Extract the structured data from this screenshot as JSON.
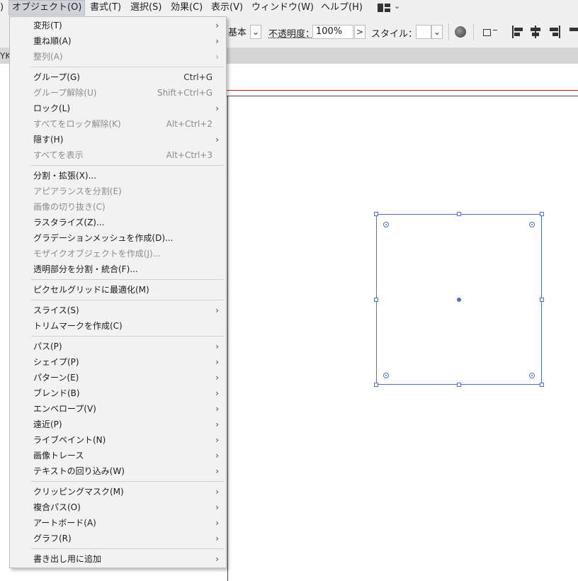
{
  "menubar": {
    "partial_left": ")",
    "items": [
      "オブジェクト(O)",
      "書式(T)",
      "選択(S)",
      "効果(C)",
      "表示(V)",
      "ウィンドウ(W)",
      "ヘルプ(H)"
    ],
    "active": "オブジェクト(O)",
    "workspace_icon": "workspace-switcher-icon"
  },
  "controlbar": {
    "brush_value": "基本",
    "opacity_label": "不透明度：",
    "opacity_value": "100%",
    "style_label": "スタイル：",
    "chevron_down": "⌄",
    "chevron_right": ">",
    "icons": [
      "recolor-globe-icon",
      "transform-shape-icon",
      "align-left-icon",
      "align-hcenter-icon",
      "align-right-icon"
    ]
  },
  "tabstrip": {
    "fragment": "YK"
  },
  "object_menu": {
    "items": [
      {
        "label": "変形(T)",
        "submenu": true
      },
      {
        "label": "重ね順(A)",
        "submenu": true
      },
      {
        "label": "整列(A)",
        "submenu": true,
        "disabled": true
      },
      {
        "label": "グループ(G)",
        "shortcut": "Ctrl+G"
      },
      {
        "label": "グループ解除(U)",
        "shortcut": "Shift+Ctrl+G",
        "disabled": true
      },
      {
        "label": "ロック(L)",
        "submenu": true
      },
      {
        "label": "すべてをロック解除(K)",
        "shortcut": "Alt+Ctrl+2",
        "disabled": true
      },
      {
        "label": "隠す(H)",
        "submenu": true
      },
      {
        "label": "すべてを表示",
        "shortcut": "Alt+Ctrl+3",
        "disabled": true
      },
      {
        "label": "分割・拡張(X)..."
      },
      {
        "label": "アピアランスを分割(E)",
        "disabled": true
      },
      {
        "label": "画像の切り抜き(C)",
        "disabled": true
      },
      {
        "label": "ラスタライズ(Z)..."
      },
      {
        "label": "グラデーションメッシュを作成(D)..."
      },
      {
        "label": "モザイクオブジェクトを作成(J)...",
        "disabled": true
      },
      {
        "label": "透明部分を分割・統合(F)..."
      },
      {
        "label": "ピクセルグリッドに最適化(M)"
      },
      {
        "label": "スライス(S)",
        "submenu": true
      },
      {
        "label": "トリムマークを作成(C)"
      },
      {
        "label": "パス(P)",
        "submenu": true
      },
      {
        "label": "シェイプ(P)",
        "submenu": true
      },
      {
        "label": "パターン(E)",
        "submenu": true
      },
      {
        "label": "ブレンド(B)",
        "submenu": true
      },
      {
        "label": "エンベロープ(V)",
        "submenu": true
      },
      {
        "label": "遠近(P)",
        "submenu": true
      },
      {
        "label": "ライブペイント(N)",
        "submenu": true
      },
      {
        "label": "画像トレース",
        "submenu": true
      },
      {
        "label": "テキストの回り込み(W)",
        "submenu": true
      },
      {
        "label": "クリッピングマスク(M)",
        "submenu": true
      },
      {
        "label": "複合パス(O)",
        "submenu": true
      },
      {
        "label": "アートボード(A)",
        "submenu": true
      },
      {
        "label": "グラフ(R)",
        "submenu": true
      },
      {
        "label": "書き出し用に追加",
        "submenu": true
      }
    ],
    "submenu_arrow": "›"
  },
  "colors": {
    "selection": "#4a6fd0",
    "artboard_bleed": "#c41e1e",
    "menu_bg": "#f2f2f2",
    "disabled_text": "#8c8c8c"
  }
}
